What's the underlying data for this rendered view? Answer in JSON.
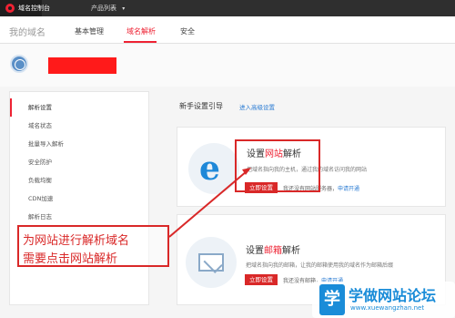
{
  "topbar": {
    "app_title": "域名控制台",
    "product_menu": "产品列表"
  },
  "header": {
    "domain_title": "我的域名",
    "tabs": [
      {
        "label": "基本管理"
      },
      {
        "label": "域名解析"
      },
      {
        "label": "安全"
      }
    ]
  },
  "sidebar": {
    "items": [
      {
        "label": "解析设置"
      },
      {
        "label": "域名状态"
      },
      {
        "label": "批量导入解析"
      },
      {
        "label": "安全防护"
      },
      {
        "label": "负载均衡"
      },
      {
        "label": "CDN加速"
      },
      {
        "label": "解析日志"
      }
    ]
  },
  "guide": {
    "title": "新手设置引导",
    "link": "进入高级设置"
  },
  "website_card": {
    "heading_prefix": "设置",
    "heading_accent": "网站",
    "heading_suffix": "解析",
    "description": "把域名指向我的主机，通过我的域名访问我的网站",
    "button": "立即设置",
    "hint": "我还没有网站服务器，",
    "hint_link": "申请开通"
  },
  "email_card": {
    "heading_prefix": "设置",
    "heading_accent": "邮箱",
    "heading_suffix": "解析",
    "description": "把域名指向我的邮箱，让我的邮箱使用我的域名作为邮箱后缀",
    "button": "立即设置",
    "hint": "我还没有邮箱，",
    "hint_link": "申请开通"
  },
  "annotation": {
    "line1": "为网站进行解析域名",
    "line2": "需要点击网站解析"
  },
  "watermark": {
    "icon_glyph": "学",
    "title": "学做网站论坛",
    "url": "www.xuewangzhan.net"
  },
  "colors": {
    "accent": "#e22233",
    "link": "#2b7cd3",
    "button": "#d92828",
    "watermark": "#1a8cd8"
  },
  "icons": [
    "logo-icon",
    "chevron-down-icon",
    "globe-icon",
    "ie-browser-icon",
    "mail-icon",
    "watermark-logo-icon"
  ]
}
